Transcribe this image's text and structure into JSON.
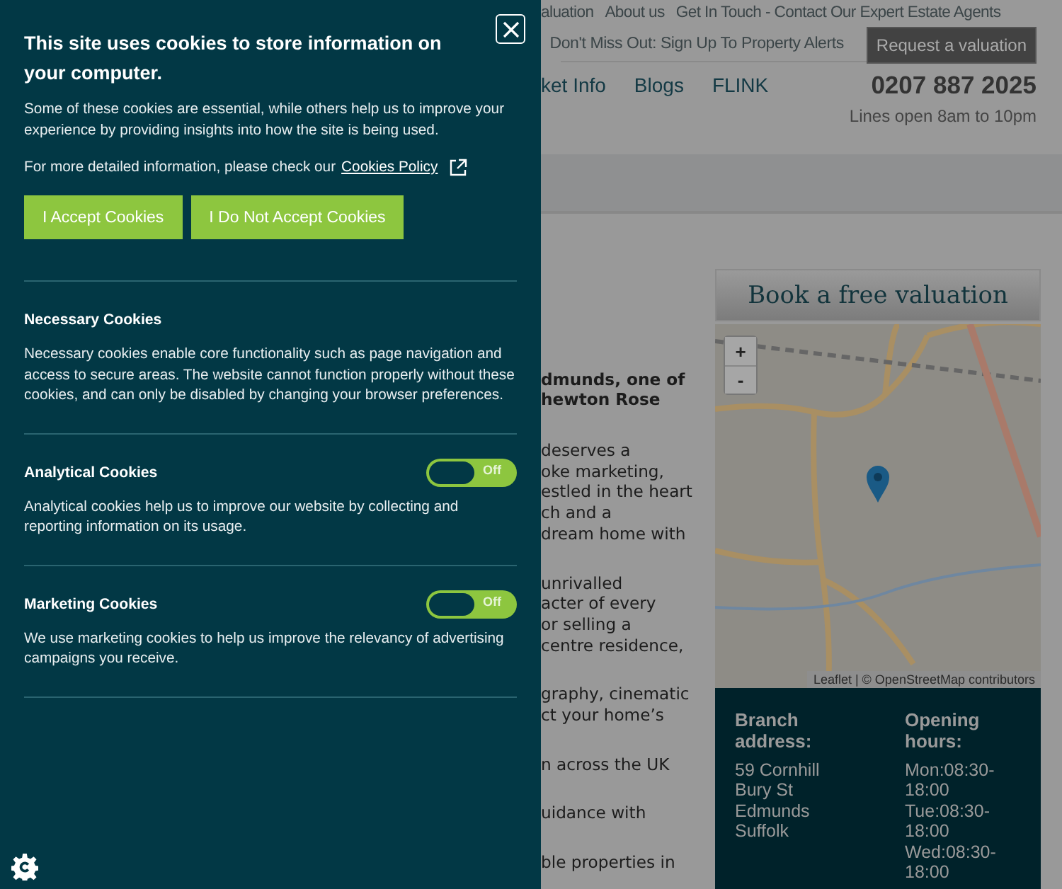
{
  "cookie_panel": {
    "title": "This site uses cookies to store information on your computer.",
    "intro": "Some of these cookies are essential, while others help us to improve your experience by providing insights into how the site is being used.",
    "policy_text": "For more detailed information, please check our",
    "policy_link": "Cookies Policy",
    "buttons": [
      {
        "label": "I Accept Cookies"
      },
      {
        "label": "I Do Not Accept Cookies"
      }
    ],
    "sections": [
      {
        "kind": "info",
        "title": "Necessary Cookies",
        "text": "Necessary cookies enable core functionality such as page navigation and access to secure areas. The website cannot function properly without these cookies, and can only be disabled by changing your browser preferences."
      },
      {
        "kind": "toggle",
        "title": "Analytical Cookies",
        "text": "Analytical cookies help us to improve our website by collecting and reporting information on its usage.",
        "toggle_label": "Off",
        "on": false
      },
      {
        "kind": "toggle",
        "title": "Marketing Cookies",
        "text": "We use marketing cookies to help us improve the relevancy of advertising campaigns you receive.",
        "toggle_label": "Off",
        "on": false
      }
    ]
  },
  "top_links": [
    "aluation",
    "About us",
    "Get In Touch - Contact Our Expert Estate Agents"
  ],
  "secondary_link": "Don't Miss Out: Sign Up To Property Alerts",
  "request_button": "Request a valuation",
  "nav": [
    "ket Info",
    "Blogs",
    "FLINK"
  ],
  "phone": "0207 887 2025",
  "phone_hours": "Lines open 8am to 10pm",
  "article": {
    "heading_lines": [
      "dmunds, one of",
      "hewton Rose"
    ],
    "paragraphs": [
      [
        "deserves a",
        "oke marketing,",
        "estled in the heart",
        "ch and a",
        "dream home with"
      ],
      [
        "unrivalled",
        "acter of every",
        "or selling a",
        "centre residence,"
      ],
      [
        "graphy, cinematic",
        "ct your home’s"
      ],
      [
        "n across the UK"
      ],
      [
        "uidance with"
      ],
      [
        "ble properties in"
      ]
    ]
  },
  "valuation_card": {
    "title": "Book a free valuation",
    "zoom_in": "+",
    "zoom_out": "-",
    "attribution": "Leaflet | © OpenStreetMap contributors",
    "address_heading": "Branch address:",
    "address": [
      "59 Cornhill",
      "Bury St Edmunds",
      "Suffolk"
    ],
    "hours_heading": "Opening hours:",
    "hours": [
      "Mon:08:30-18:00",
      "Tue:08:30-18:00",
      "Wed:08:30-18:00"
    ]
  }
}
